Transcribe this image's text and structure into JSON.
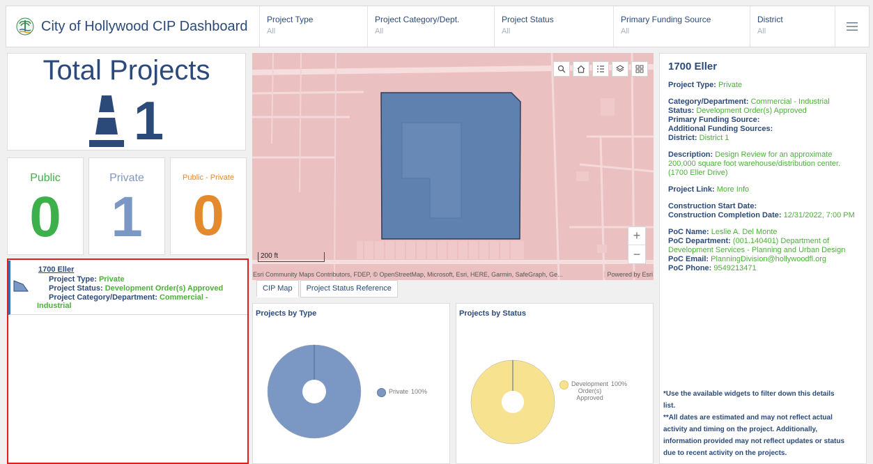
{
  "header": {
    "title": "City of Hollywood CIP Dashboard",
    "filters": [
      {
        "label": "Project Type",
        "value": "All"
      },
      {
        "label": "Project Category/Dept.",
        "value": "All"
      },
      {
        "label": "Project Status",
        "value": "All"
      },
      {
        "label": "Primary Funding Source",
        "value": "All"
      },
      {
        "label": "District",
        "value": "All"
      }
    ]
  },
  "total": {
    "title": "Total Projects",
    "count": "1"
  },
  "stats": [
    {
      "label": "Public",
      "value": "0",
      "color": "#3db04b"
    },
    {
      "label": "Private",
      "value": "1",
      "color": "#7b98c4"
    },
    {
      "label": "Public - Private",
      "value": "0",
      "color": "#e38a2c"
    }
  ],
  "list": {
    "name": "1700 Eller",
    "type_label": "Project Type:",
    "type_value": "Private",
    "status_label": "Project Status:",
    "status_value": "Development Order(s) Approved",
    "category_label": "Project Category/Department:",
    "category_value_1": "Commercial -",
    "category_value_2": "Industrial"
  },
  "map": {
    "scale": "200 ft",
    "attribution": "Esri Community Maps Contributors, FDEP, © OpenStreetMap, Microsoft, Esri, HERE, Garmin, SafeGraph, Ge...",
    "powered": "Powered by Esri",
    "tabs": [
      "CIP Map",
      "Project Status Reference"
    ]
  },
  "charts": {
    "by_type": {
      "title": "Projects by Type",
      "legend": "Private",
      "pct": "100%"
    },
    "by_status": {
      "title": "Projects by Status",
      "legend_1": "Development",
      "legend_2": "Order(s)",
      "legend_3": "Approved",
      "pct": "100%"
    }
  },
  "chart_data": [
    {
      "type": "pie",
      "title": "Projects by Type",
      "categories": [
        "Private"
      ],
      "values": [
        100
      ],
      "colors": [
        "#7b98c4"
      ]
    },
    {
      "type": "pie",
      "title": "Projects by Status",
      "categories": [
        "Development Order(s) Approved"
      ],
      "values": [
        100
      ],
      "colors": [
        "#f7e38f"
      ]
    }
  ],
  "detail": {
    "title": "1700 Eller",
    "type_label": "Project Type:",
    "type_value": "Private",
    "category_label": "Category/Department:",
    "category_value": "Commercial - Industrial",
    "status_label": "Status:",
    "status_value": "Development Order(s) Approved",
    "primary_label": "Primary Funding Source:",
    "additional_label": "Additional Funding Sources:",
    "district_label": "District:",
    "district_value": "District 1",
    "desc_label": "Description:",
    "desc_1": "Design Review for an approximate",
    "desc_2": "200,000 square foot warehouse/distribution center.",
    "desc_3": "(1700 Eller Drive)",
    "link_label": "Project Link:",
    "link_value": "More Info",
    "start_label": "Construction Start Date:",
    "completion_label": "Construction Completion Date:",
    "completion_value": "12/31/2022, 7:00 PM",
    "poc_name_label": "PoC Name:",
    "poc_name_value": "Leslie A. Del Monte",
    "poc_dept_label": "PoC Department:",
    "poc_dept_1": "(001.140401) Department of",
    "poc_dept_2": "Development Services - Planning and Urban Design",
    "poc_email_label": "PoC Email:",
    "poc_email_value": "PlanningDivision@hollywoodfl.org",
    "poc_phone_label": "PoC Phone:",
    "poc_phone_value": "9549213471",
    "note_1": "*Use the available widgets to filter down this details",
    "note_2": "list.",
    "note_3": "**All dates are estimated and may not reflect actual",
    "note_4": "activity and timing on the project. Additionally,",
    "note_5": "information provided may not reflect updates or status",
    "note_6": "due to recent activity on the projects."
  },
  "icons": {
    "logo": "city-seal-icon",
    "menu": "hamburger-menu-icon",
    "cone": "traffic-cone-icon"
  },
  "colors": {
    "accent": "#2b4a7a",
    "green": "#4caf3a",
    "highlight": "#e11d1d"
  }
}
